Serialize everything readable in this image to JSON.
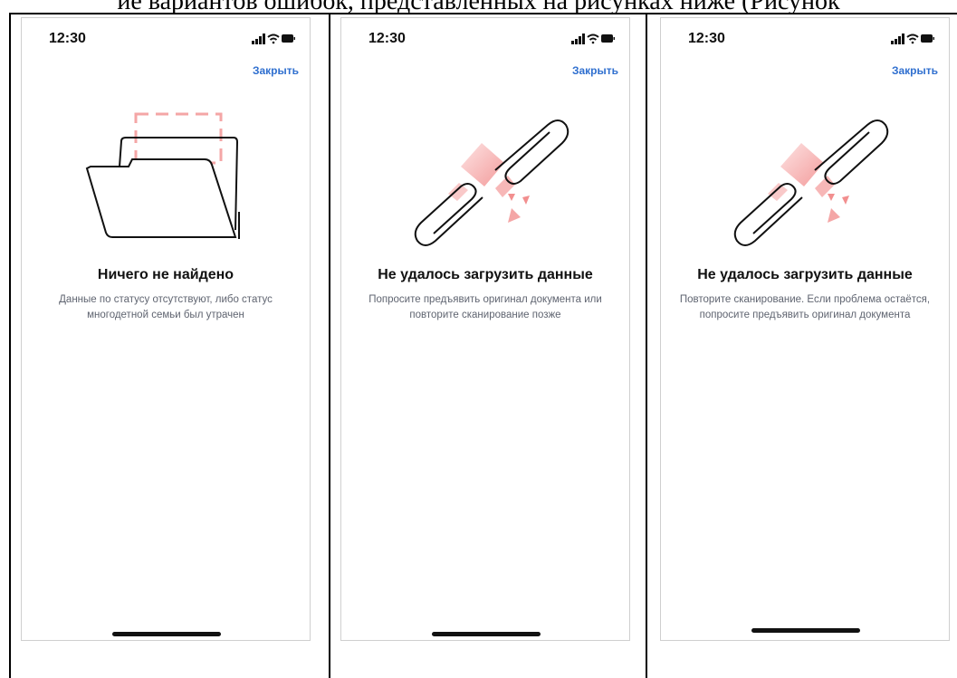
{
  "document": {
    "header_fragment": "ие вариантов ошибок, представленных на рисунках ниже (Рисунок"
  },
  "screens": [
    {
      "time": "12:30",
      "close_label": "Закрыть",
      "illustration": "empty-folder",
      "title": "Ничего не найдено",
      "description": "Данные по статусу отсутствуют, либо статус многодетной семьи был утрачен"
    },
    {
      "time": "12:30",
      "close_label": "Закрыть",
      "illustration": "broken-chain",
      "title": "Не удалось загрузить данные",
      "description": "Попросите предъявить оригинал документа или повторите сканирование позже"
    },
    {
      "time": "12:30",
      "close_label": "Закрыть",
      "illustration": "broken-chain",
      "title": "Не удалось загрузить данные",
      "description": "Повторите сканирование. Если проблема остаётся, попросите предъявить оригинал документа"
    }
  ],
  "icons": {
    "signal": "signal-icon",
    "wifi": "wifi-icon",
    "battery": "battery-icon"
  },
  "colors": {
    "accent": "#2f6fcf",
    "illustration_pink": "#f4a6a6",
    "text_muted": "#5f6470"
  }
}
